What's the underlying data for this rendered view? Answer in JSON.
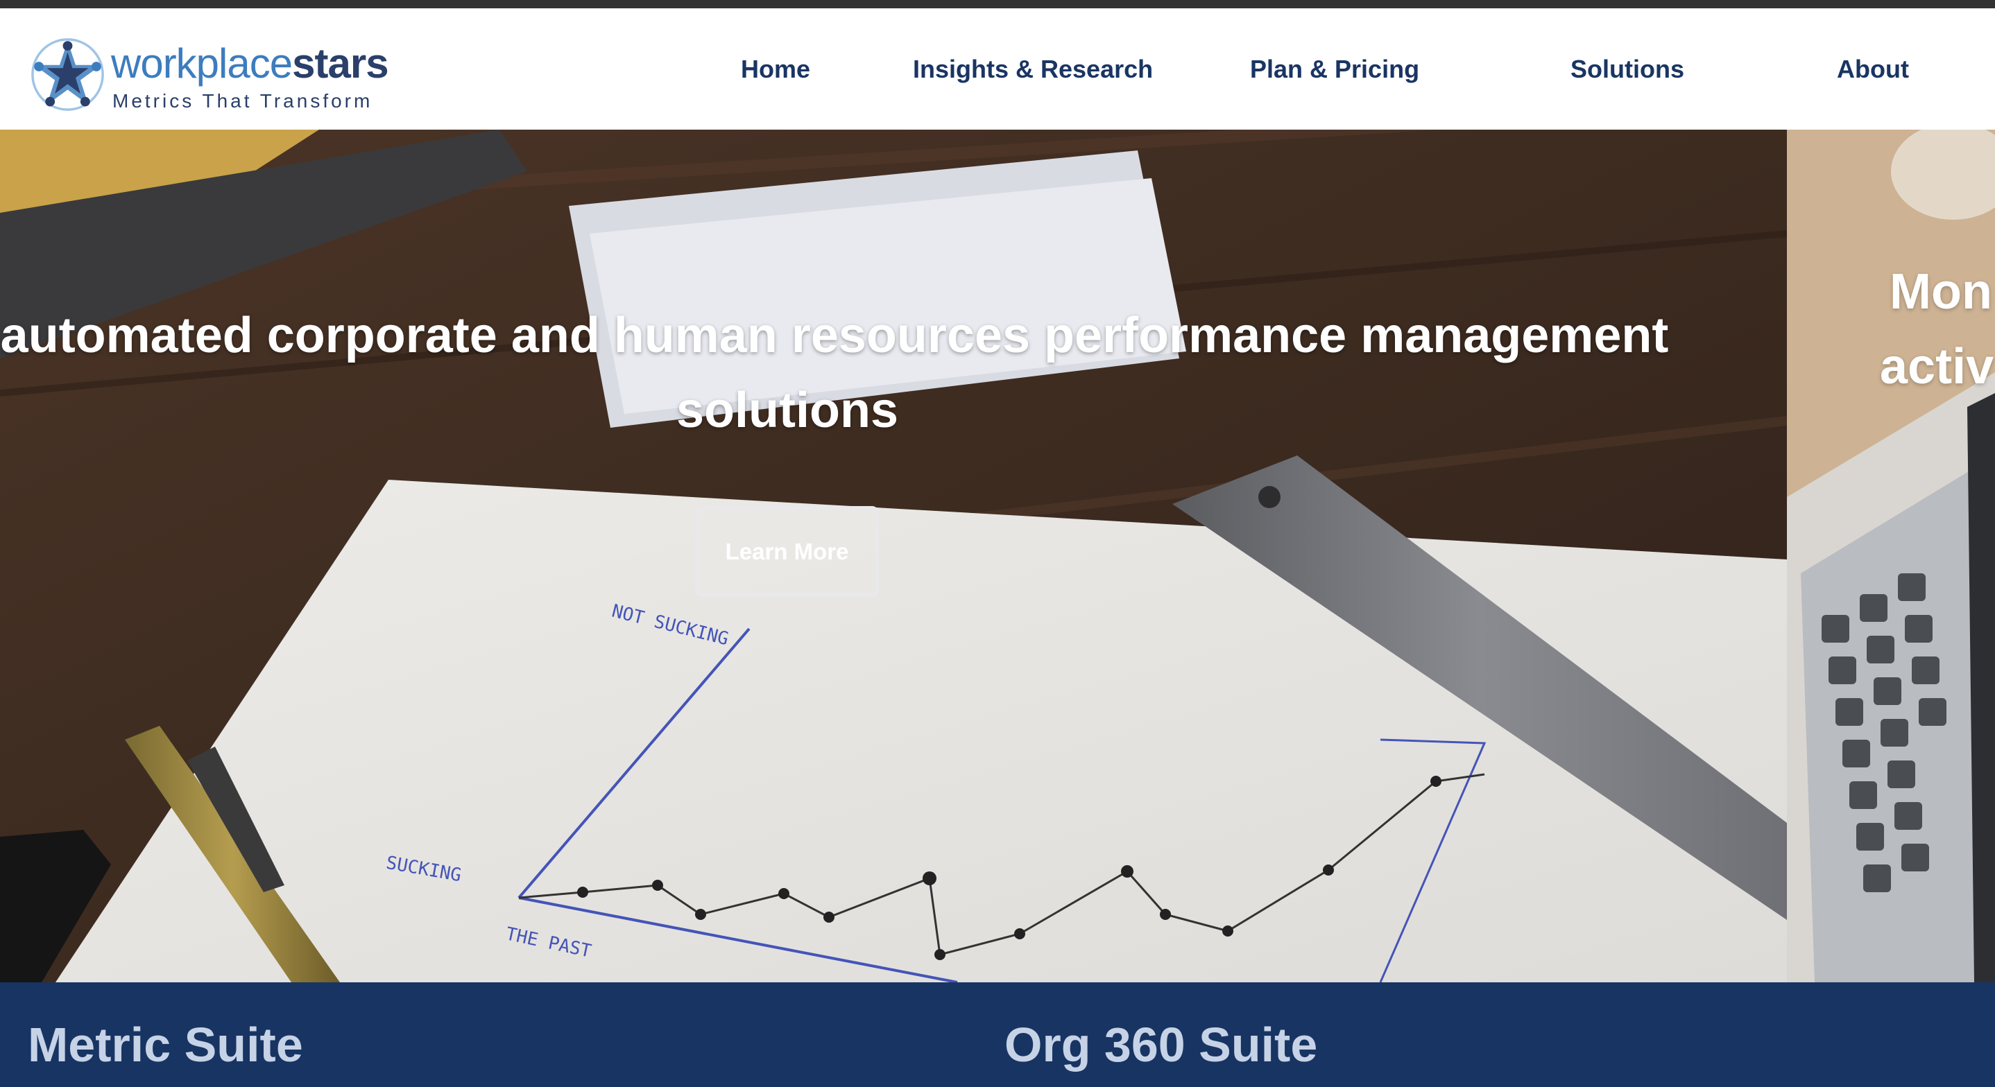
{
  "brand": {
    "name_light": "workplace",
    "name_bold": "stars",
    "tagline": "Metrics That Transform",
    "colors": {
      "primary": "#1a3563",
      "accent": "#3c7dbe",
      "band": "#173463"
    }
  },
  "nav": {
    "items": [
      {
        "label": "Home"
      },
      {
        "label": "Insights & Research"
      },
      {
        "label": "Plan & Pricing"
      },
      {
        "label": "Solutions"
      },
      {
        "label": "About"
      }
    ]
  },
  "hero": {
    "title_line1": "ffer automated corporate and human resources performance management",
    "title_line2": "solutions",
    "cta_label": "Learn More",
    "photo_annotations": {
      "top": "NOT SUCKING",
      "left": "SUCKING",
      "bottom": "THE PAST"
    }
  },
  "next_slide": {
    "line1": "Mon",
    "line2": "activ"
  },
  "suites": [
    {
      "title": "Metric Suite"
    },
    {
      "title": "Org 360 Suite"
    }
  ]
}
